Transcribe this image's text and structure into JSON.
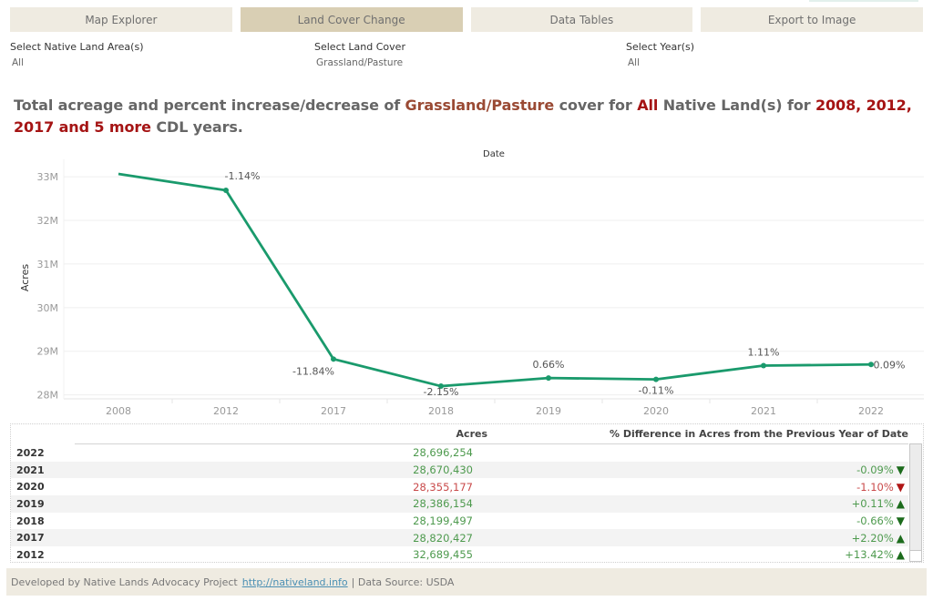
{
  "nav": {
    "tabs": [
      {
        "label": "Map Explorer",
        "active": false
      },
      {
        "label": "Land Cover Change",
        "active": true
      },
      {
        "label": "Data Tables",
        "active": false
      },
      {
        "label": "Export to Image",
        "active": false
      }
    ]
  },
  "filters": {
    "native_land": {
      "label": "Select Native Land Area(s)",
      "value": "All"
    },
    "land_cover": {
      "label": "Select Land Cover",
      "value": "Grassland/Pasture"
    },
    "years": {
      "label": "Select Year(s)",
      "value": "All"
    }
  },
  "title": {
    "part1": "Total acreage and percent increase/decrease of ",
    "land_cover": "Grassland/Pasture",
    "part2": " cover for ",
    "area": "All",
    "part3": " Native Land(s) for ",
    "years": "2008, 2012, 2017 and 5 more",
    "part4": " CDL years."
  },
  "colors": {
    "line": "#1a9a6c",
    "positive": "#4e9a4e",
    "negative": "#c94a4a",
    "up_arrow": "#1c6b1c",
    "down_arrow_green": "#1c6b1c",
    "down_arrow_red": "#b01515",
    "title_accent": "#a51414",
    "land_cover_accent": "#9a4a34"
  },
  "chart_data": {
    "type": "line",
    "title": "",
    "xlabel": "Date",
    "ylabel": "Acres",
    "categories": [
      "2008",
      "2012",
      "2017",
      "2018",
      "2019",
      "2020",
      "2021",
      "2022"
    ],
    "series": [
      {
        "name": "Acres",
        "values": [
          33066000,
          32689455,
          28820427,
          28199497,
          28386154,
          28355177,
          28670430,
          28696254
        ],
        "labels": [
          "",
          "-1.14%",
          "-11.84%",
          "-2.15%",
          "0.66%",
          "-0.11%",
          "1.11%",
          "0.09%"
        ]
      }
    ],
    "yticks": [
      "28M",
      "29M",
      "30M",
      "31M",
      "32M",
      "33M"
    ],
    "ylim": [
      27950000,
      33400000
    ],
    "grid": true,
    "legend": "none"
  },
  "table": {
    "headers": {
      "acres": "Acres",
      "pct": "% Difference in Acres from the Previous Year of Date"
    },
    "rows": [
      {
        "year": "2022",
        "acres": "28,696,254",
        "acres_color": "positive",
        "pct": "",
        "arrow": ""
      },
      {
        "year": "2021",
        "acres": "28,670,430",
        "acres_color": "positive",
        "pct": "-0.09%",
        "pct_color": "positive",
        "arrow": "▼",
        "arrow_color": "down_arrow_green"
      },
      {
        "year": "2020",
        "acres": "28,355,177",
        "acres_color": "negative",
        "pct": "-1.10%",
        "pct_color": "negative",
        "arrow": "▼",
        "arrow_color": "down_arrow_red"
      },
      {
        "year": "2019",
        "acres": "28,386,154",
        "acres_color": "positive",
        "pct": "+0.11%",
        "pct_color": "positive",
        "arrow": "▲",
        "arrow_color": "up_arrow"
      },
      {
        "year": "2018",
        "acres": "28,199,497",
        "acres_color": "positive",
        "pct": "-0.66%",
        "pct_color": "positive",
        "arrow": "▼",
        "arrow_color": "down_arrow_green"
      },
      {
        "year": "2017",
        "acres": "28,820,427",
        "acres_color": "positive",
        "pct": "+2.20%",
        "pct_color": "positive",
        "arrow": "▲",
        "arrow_color": "up_arrow"
      },
      {
        "year": "2012",
        "acres": "32,689,455",
        "acres_color": "positive",
        "pct": "+13.42%",
        "pct_color": "positive",
        "arrow": "▲",
        "arrow_color": "up_arrow"
      }
    ]
  },
  "footer": {
    "developed_by": "Developed by Native Lands Advocacy Project",
    "link": "http://nativeland.info",
    "source": "| Data Source: USDA"
  }
}
